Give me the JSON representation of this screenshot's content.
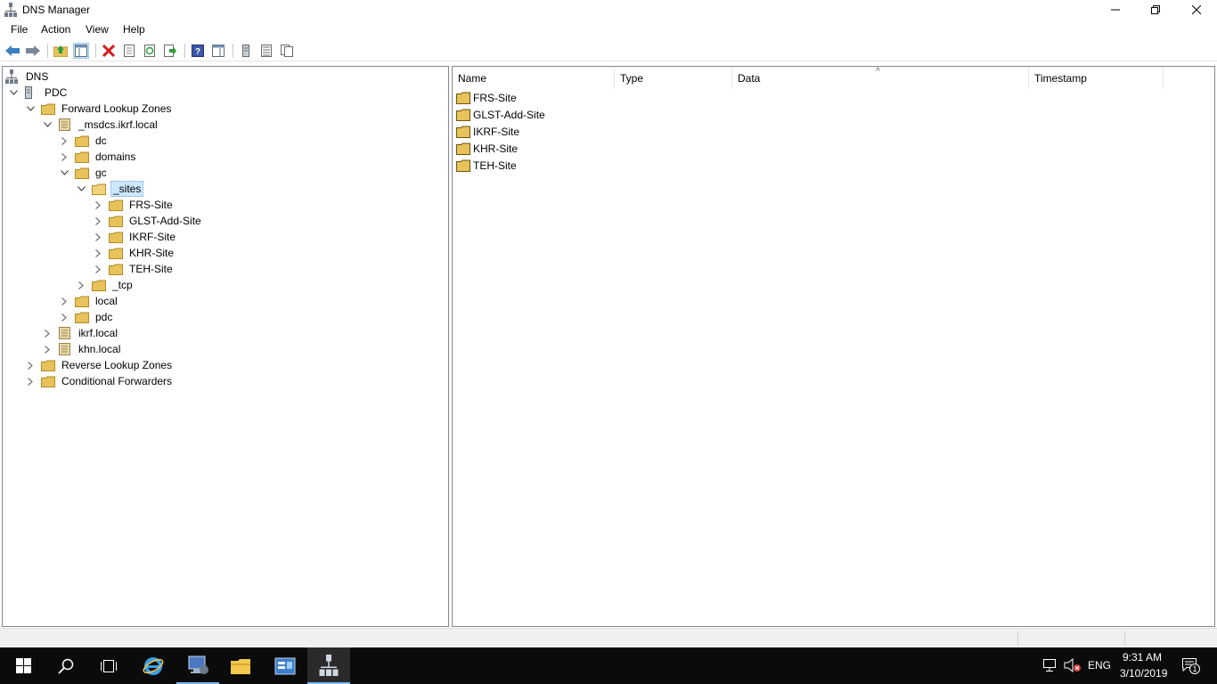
{
  "window": {
    "title": "DNS Manager"
  },
  "menu": [
    "File",
    "Action",
    "View",
    "Help"
  ],
  "tree": {
    "root": "DNS",
    "server": "PDC",
    "forward_zones": "Forward Lookup Zones",
    "msdcs": "_msdcs.ikrf.local",
    "dc": "dc",
    "domains": "domains",
    "gc": "gc",
    "sites": "_sites",
    "site_children": [
      "FRS-Site",
      "GLST-Add-Site",
      "IKRF-Site",
      "KHR-Site",
      "TEH-Site"
    ],
    "tcp": "_tcp",
    "local": "local",
    "pdc": "pdc",
    "ikrf": "ikrf.local",
    "khn": "khn.local",
    "reverse_zones": "Reverse Lookup Zones",
    "conditional": "Conditional Forwarders"
  },
  "list": {
    "columns": [
      "Name",
      "Type",
      "Data",
      "Timestamp"
    ],
    "sort_indicator": "^",
    "rows": [
      "FRS-Site",
      "GLST-Add-Site",
      "IKRF-Site",
      "KHR-Site",
      "TEH-Site"
    ]
  },
  "taskbar": {
    "language": "ENG",
    "time": "9:31 AM",
    "date": "3/10/2019",
    "notification_count": "1"
  },
  "colors": {
    "folder": "#e8c25a",
    "selection": "#cce8ff",
    "taskbar": "#0b0b0b",
    "accent": "#76b9ed"
  }
}
